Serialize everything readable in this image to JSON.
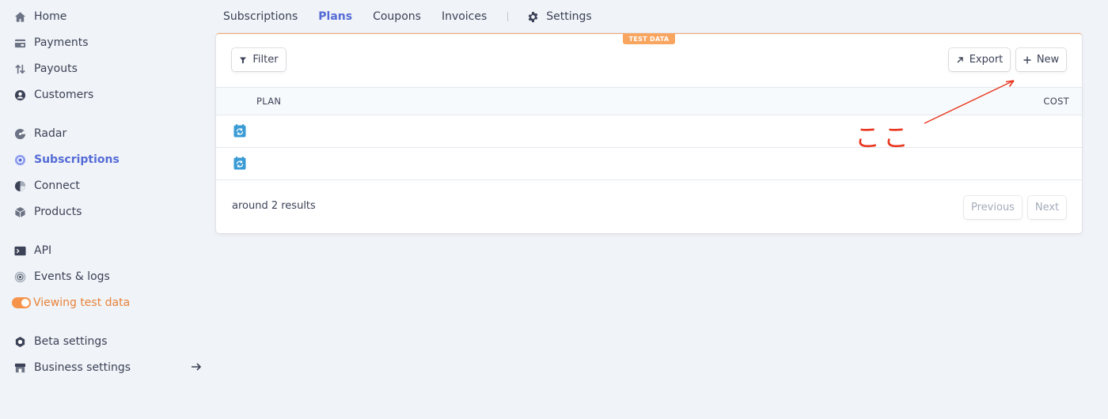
{
  "sidebar": {
    "items": [
      {
        "label": "Home",
        "icon": "home-icon"
      },
      {
        "label": "Payments",
        "icon": "payments-icon"
      },
      {
        "label": "Payouts",
        "icon": "payouts-icon"
      },
      {
        "label": "Customers",
        "icon": "customers-icon"
      },
      {
        "label": "Radar",
        "icon": "radar-icon"
      },
      {
        "label": "Subscriptions",
        "icon": "subscriptions-icon",
        "active": true
      },
      {
        "label": "Connect",
        "icon": "connect-icon"
      },
      {
        "label": "Products",
        "icon": "products-icon"
      },
      {
        "label": "API",
        "icon": "terminal-icon"
      },
      {
        "label": "Events & logs",
        "icon": "events-icon"
      },
      {
        "label": "Viewing test data",
        "icon": "toggle-icon",
        "toggle_on": true
      },
      {
        "label": "Beta settings",
        "icon": "beta-icon"
      },
      {
        "label": "Business settings",
        "icon": "store-icon"
      }
    ]
  },
  "tabs": {
    "items": [
      "Subscriptions",
      "Plans",
      "Coupons",
      "Invoices"
    ],
    "active": "Plans",
    "settings_label": "Settings"
  },
  "card": {
    "badge": "TEST DATA",
    "filter_label": "Filter",
    "export_label": "Export",
    "new_label": "New",
    "columns": {
      "plan": "PLAN",
      "cost": "COST"
    },
    "rows": [
      {
        "icon": "recurring-plan-icon",
        "name": "",
        "cost": ""
      },
      {
        "icon": "recurring-plan-icon",
        "name": "",
        "cost": ""
      }
    ],
    "results_text": "around 2 results",
    "previous_label": "Previous",
    "next_label": "Next"
  },
  "annotation": {
    "text": "ここ",
    "color": "#e8341c"
  },
  "colors": {
    "accent": "#556cd6",
    "test_orange": "#f5934b",
    "page_bg": "#f0f3f7"
  }
}
